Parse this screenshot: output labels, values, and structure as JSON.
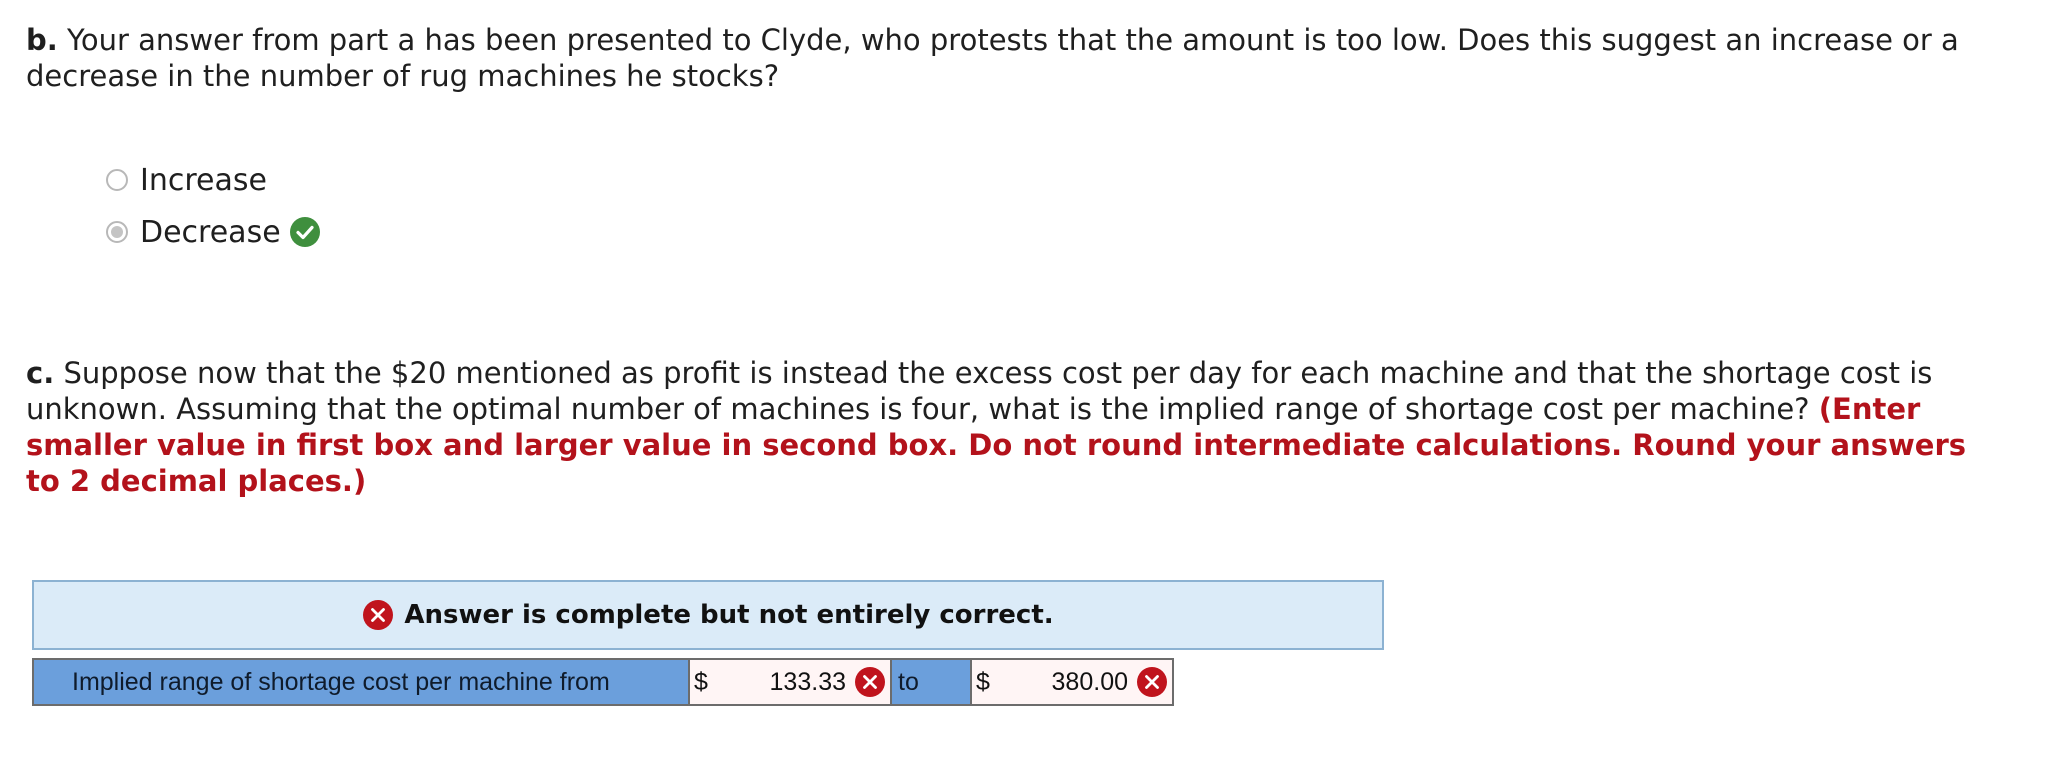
{
  "part_b": {
    "letter": "b.",
    "question": "Your answer from part a has been presented to Clyde, who protests that the amount is too low. Does this suggest an increase or a decrease in the number of rug machines he stocks?",
    "options": [
      {
        "label": "Increase",
        "selected": false
      },
      {
        "label": "Decrease",
        "selected": true,
        "feedback": "correct"
      }
    ]
  },
  "part_c": {
    "letter": "c.",
    "question": "Suppose now that the $20 mentioned as profit is instead the excess cost per day for each machine and that the shortage cost is unknown. Assuming that the optimal number of machines is four, what is the implied range of shortage cost per machine?",
    "instructions": "(Enter smaller value in first box and larger value in second box. Do not round intermediate calculations. Round your answers to 2 decimal places.)"
  },
  "feedback": {
    "message": "Answer is complete but not entirely correct.",
    "icon": "x-circle-icon"
  },
  "answer_row": {
    "label": "Implied range of shortage cost per machine from",
    "currency_symbol": "$",
    "value_low": "133.33",
    "connector": "to",
    "value_high": "380.00",
    "status_low": "incorrect",
    "status_high": "incorrect"
  },
  "colors": {
    "instruction_red": "#b3121b",
    "correct_green": "#3f8f3e",
    "incorrect_red": "#c0141d",
    "banner_bg": "#dbebf8",
    "label_cell_blue": "#6b9fdc"
  }
}
